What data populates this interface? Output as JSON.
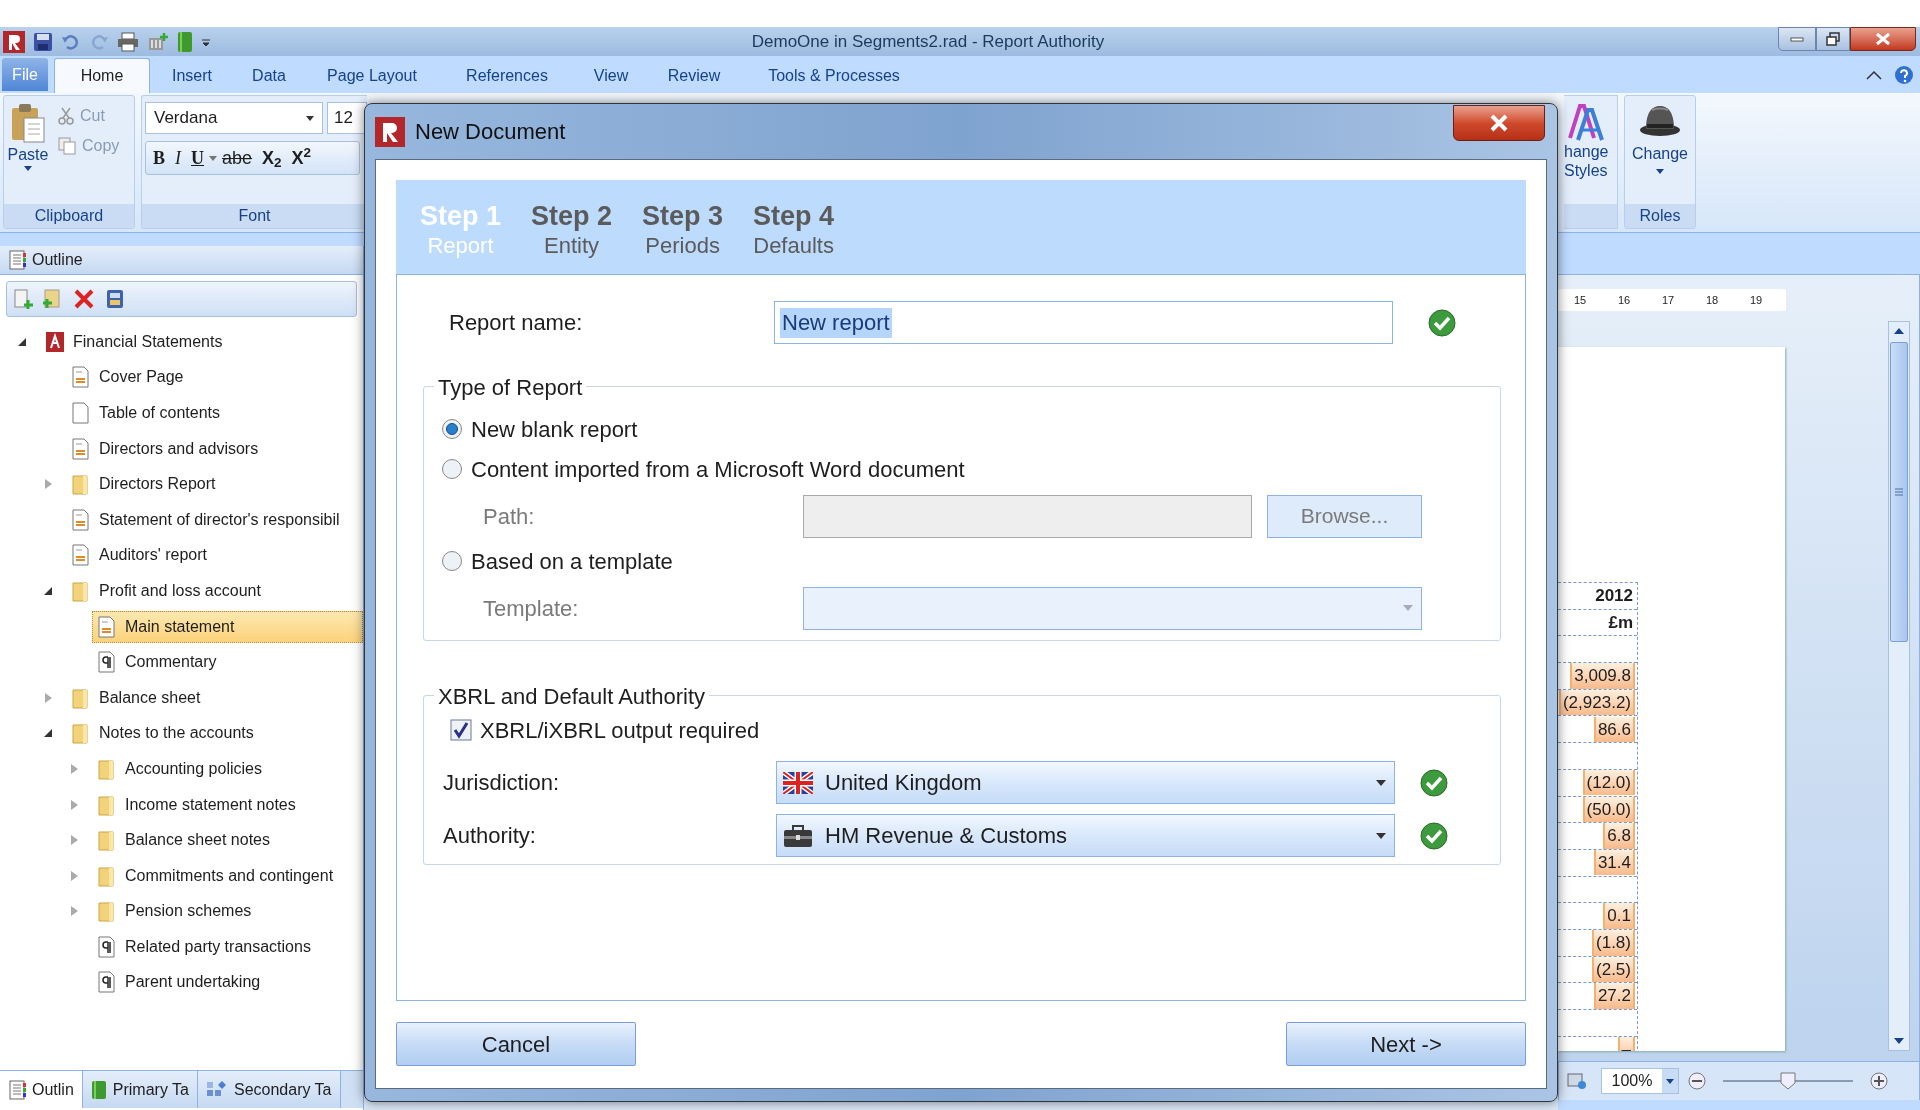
{
  "window": {
    "title": "DemoOne in Segments2.rad - Report Authority"
  },
  "ribbon_tabs": [
    {
      "label": "File",
      "selected": false,
      "kind": "file"
    },
    {
      "label": "Home",
      "selected": true
    },
    {
      "label": "Insert",
      "selected": false
    },
    {
      "label": "Data",
      "selected": false
    },
    {
      "label": "Page Layout",
      "selected": false
    },
    {
      "label": "References",
      "selected": false
    },
    {
      "label": "View",
      "selected": false
    },
    {
      "label": "Review",
      "selected": false
    },
    {
      "label": "Tools & Processes",
      "selected": false
    }
  ],
  "clipboard": {
    "paste": "Paste",
    "cut": "Cut",
    "copy": "Copy",
    "group": "Clipboard"
  },
  "font": {
    "family": "Verdana",
    "size": "12",
    "buttons": [
      "B",
      "I",
      "U",
      "abe",
      "X$_{2}$",
      "X$^{2}$"
    ],
    "group": "Font"
  },
  "styles": {
    "lines": [
      "hange",
      "Styles"
    ]
  },
  "roles": {
    "button": "Change",
    "group": "Roles"
  },
  "outline": {
    "title": "Outline",
    "tree": [
      {
        "label": "Financial Statements",
        "kind": "report",
        "expanded": true,
        "selected": false,
        "children": [
          {
            "label": "Cover Page",
            "kind": "page",
            "selected": false
          },
          {
            "label": "Table of contents",
            "kind": "blank",
            "selected": false
          },
          {
            "label": "Directors and advisors",
            "kind": "page",
            "selected": false
          },
          {
            "label": "Directors Report",
            "kind": "folder",
            "expanded": false,
            "selected": false
          },
          {
            "label": "Statement of director's responsibil",
            "kind": "page",
            "selected": false
          },
          {
            "label": "Auditors' report",
            "kind": "page",
            "selected": false
          },
          {
            "label": "Profit and loss account",
            "kind": "folder",
            "expanded": true,
            "selected": false,
            "children": [
              {
                "label": "Main statement",
                "kind": "page",
                "selected": true
              },
              {
                "label": "Commentary",
                "kind": "para",
                "selected": false
              }
            ]
          },
          {
            "label": "Balance sheet",
            "kind": "folder",
            "expanded": false,
            "selected": false
          },
          {
            "label": "Notes to the accounts",
            "kind": "folder",
            "expanded": true,
            "selected": false,
            "children": [
              {
                "label": "Accounting policies",
                "kind": "folder",
                "expanded": false,
                "selected": false
              },
              {
                "label": "Income statement notes",
                "kind": "folder",
                "expanded": false,
                "selected": false
              },
              {
                "label": "Balance sheet notes",
                "kind": "folder",
                "expanded": false,
                "selected": false
              },
              {
                "label": "Commitments and contingent",
                "kind": "folder",
                "expanded": false,
                "selected": false
              },
              {
                "label": "Pension schemes",
                "kind": "folder",
                "expanded": false,
                "selected": false
              },
              {
                "label": "Related party transactions",
                "kind": "para",
                "selected": false
              },
              {
                "label": "Parent undertaking",
                "kind": "para",
                "selected": false
              }
            ]
          }
        ]
      }
    ],
    "bottom_tabs": [
      {
        "label": "Outlin",
        "selected": true
      },
      {
        "label": "Primary Ta",
        "selected": false
      },
      {
        "label": "Secondary Ta",
        "selected": false
      }
    ]
  },
  "document": {
    "ruler": [
      "15",
      "16",
      "17",
      "18",
      "19"
    ],
    "column": [
      {
        "value": "2012",
        "kind": "header"
      },
      {
        "value": "£m",
        "kind": "header"
      },
      {
        "kind": "spacer"
      },
      {
        "value": "3,009.8"
      },
      {
        "value": "(2,923.2)"
      },
      {
        "value": "86.6"
      },
      {
        "kind": "spacer"
      },
      {
        "value": "(12.0)"
      },
      {
        "value": "(50.0)"
      },
      {
        "value": "6.8"
      },
      {
        "value": "31.4"
      },
      {
        "kind": "spacer"
      },
      {
        "value": "0.1"
      },
      {
        "value": "(1.8)"
      },
      {
        "value": "(2.5)"
      },
      {
        "value": "27.2"
      },
      {
        "kind": "spacer"
      },
      {
        "value": "–"
      }
    ],
    "zoom": "100%",
    "zoom_slider": {
      "level": 0.5
    }
  },
  "dialog": {
    "title": "New Document",
    "steps": [
      {
        "title": "Step 1",
        "subtitle": "Report",
        "selected": true
      },
      {
        "title": "Step 2",
        "subtitle": "Entity",
        "selected": false
      },
      {
        "title": "Step 3",
        "subtitle": "Periods",
        "selected": false
      },
      {
        "title": "Step 4",
        "subtitle": "Defaults",
        "selected": false
      }
    ],
    "report_name": {
      "label": "Report name:",
      "value": "New report",
      "valid": true
    },
    "type_of_report": {
      "legend": "Type of Report",
      "options": [
        {
          "label": "New blank report",
          "selected": true
        },
        {
          "label": "Content imported from a Microsoft Word document",
          "selected": false,
          "field": {
            "kind": "path",
            "label": "Path:",
            "disabled": true,
            "button": "Browse..."
          }
        },
        {
          "label": "Based on a template",
          "selected": false,
          "field": {
            "kind": "combo",
            "label": "Template:",
            "disabled": true
          }
        }
      ]
    },
    "xbrl": {
      "legend": "XBRL and Default Authority",
      "checkbox": {
        "label": "XBRL/iXBRL output required",
        "checked": true
      },
      "fields": [
        {
          "label": "Jurisdiction:",
          "value": "United Kingdom",
          "valid": true
        },
        {
          "label": "Authority:",
          "value": "HM Revenue & Customs",
          "valid": true
        }
      ]
    },
    "buttons": {
      "cancel": "Cancel",
      "next": "Next ->"
    }
  }
}
